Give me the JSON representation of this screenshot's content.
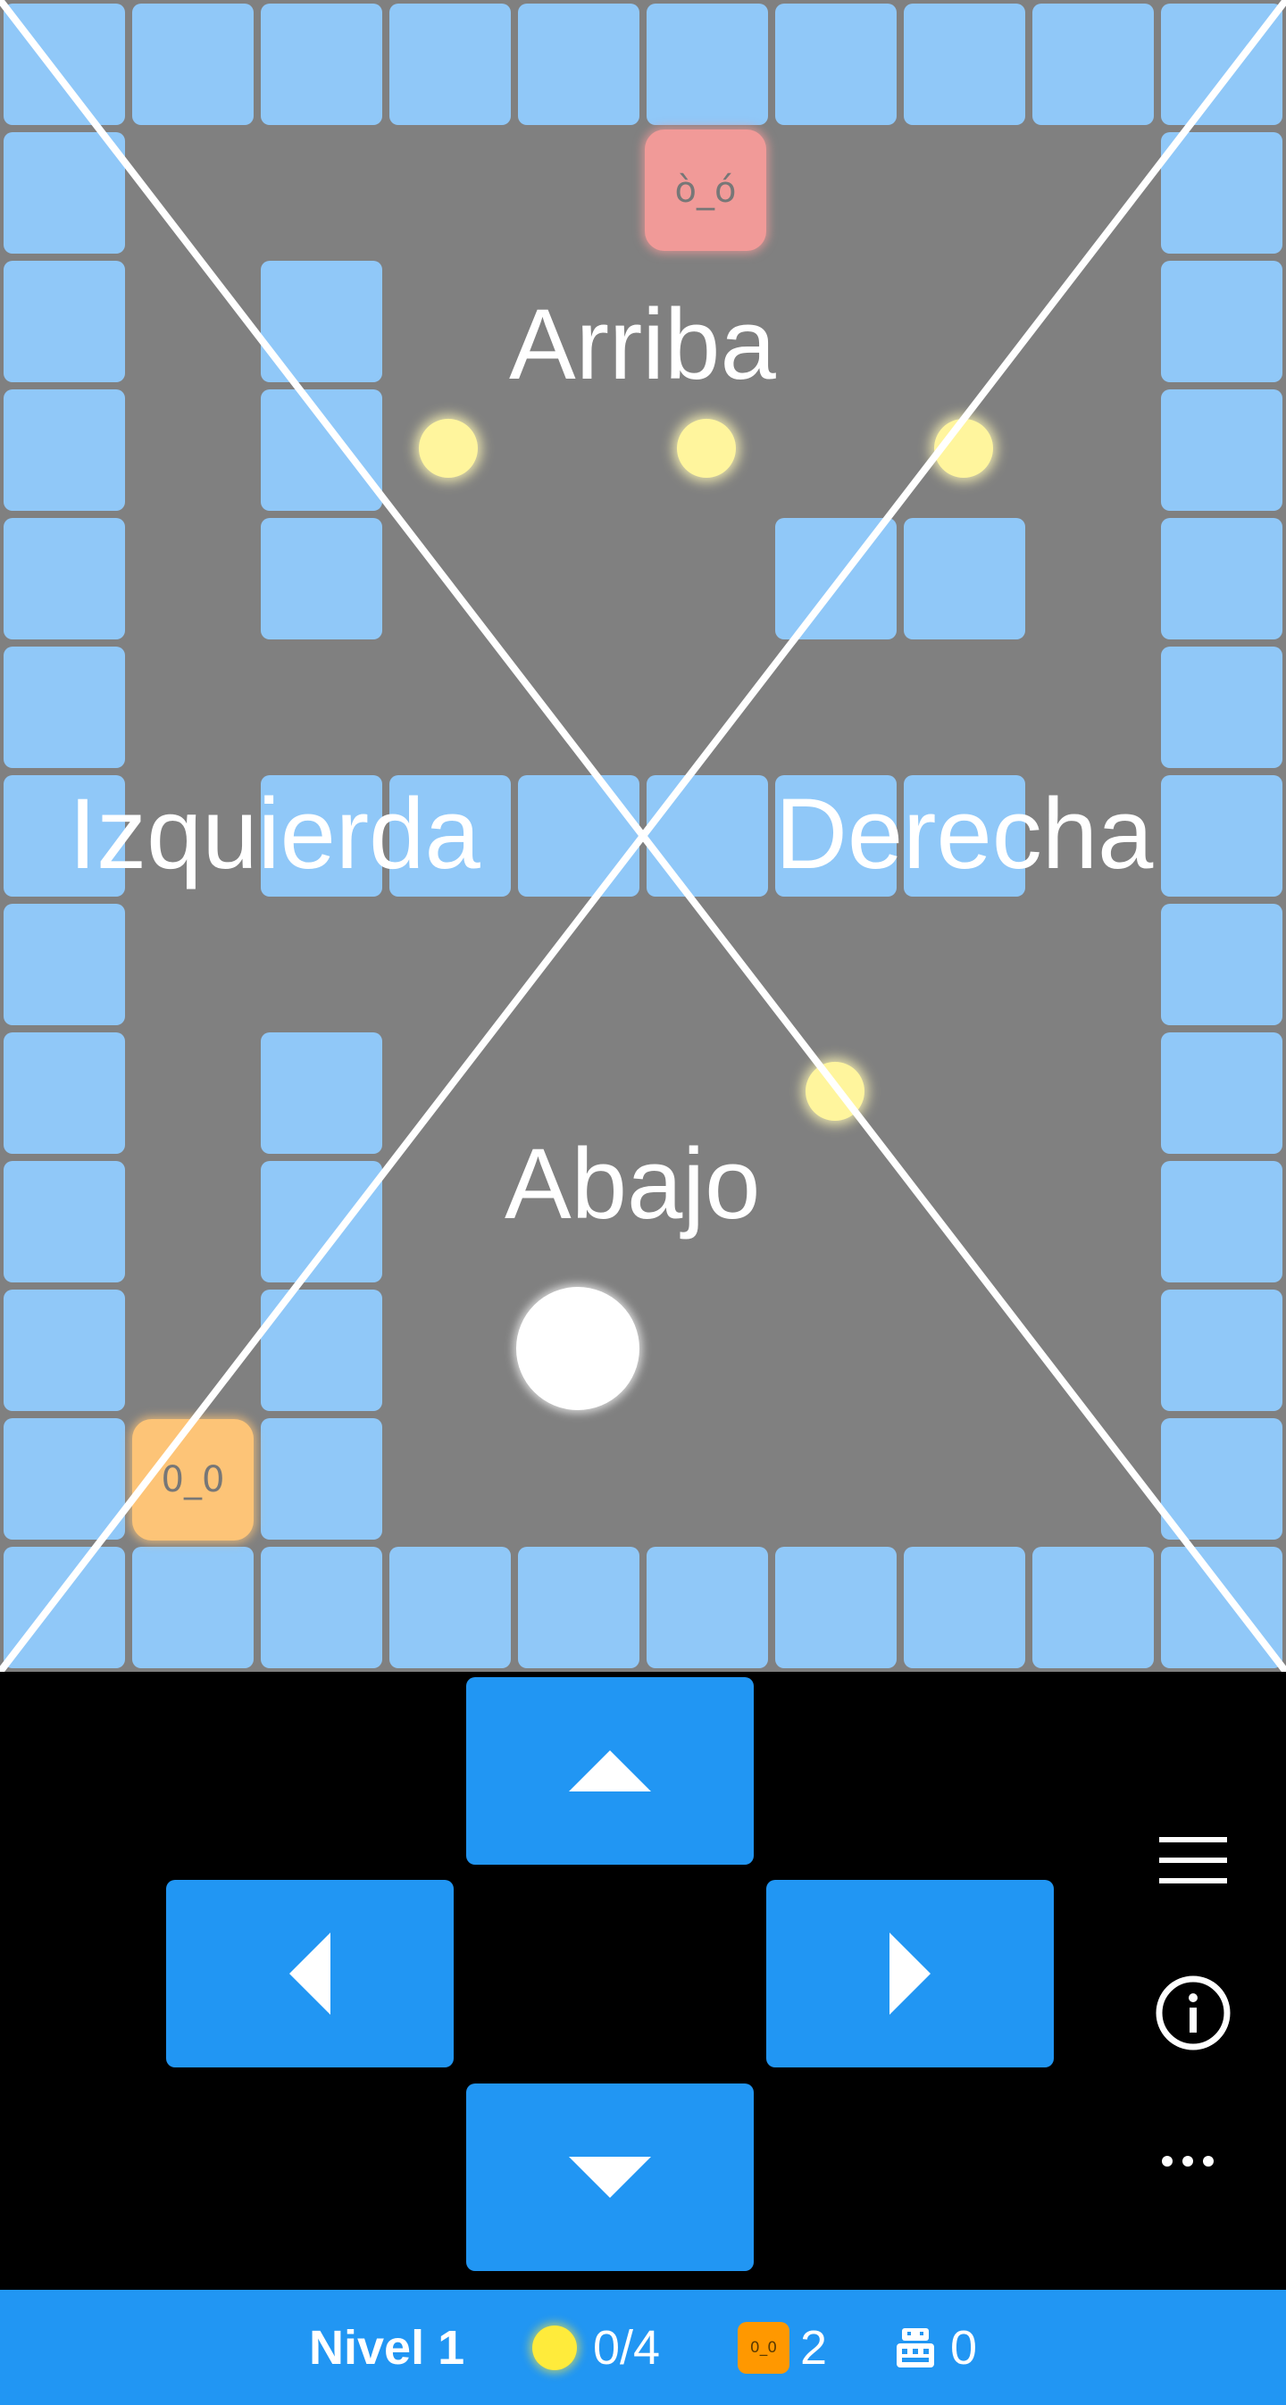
{
  "board": {
    "zone_labels": {
      "up": "Arriba",
      "left": "Izquierda",
      "right": "Derecha",
      "down": "Abajo"
    },
    "enemies": {
      "red_face": "ò_ó",
      "orange_face": "0_0"
    }
  },
  "controls": {
    "up_icon": "triangle-up-icon",
    "left_icon": "triangle-left-icon",
    "right_icon": "triangle-right-icon",
    "down_icon": "triangle-down-icon",
    "menu_icon": "hamburger-icon",
    "info_icon": "info-circle-icon",
    "more_icon": "ellipsis-icon"
  },
  "status": {
    "level_label": "Nivel 1",
    "coins_text": "0/4",
    "enemy_badge_face": "0_0",
    "enemies_count": "2",
    "moves_count": "0"
  },
  "colors": {
    "wall": "#90c8f8",
    "board_background": "#808080",
    "coin": "#fff59d",
    "enemy_red": "#f19a98",
    "enemy_orange": "#fdc477",
    "player": "#ffffff",
    "button": "#2196f3",
    "status_bar": "#2196f3",
    "controls_background": "#000000"
  }
}
